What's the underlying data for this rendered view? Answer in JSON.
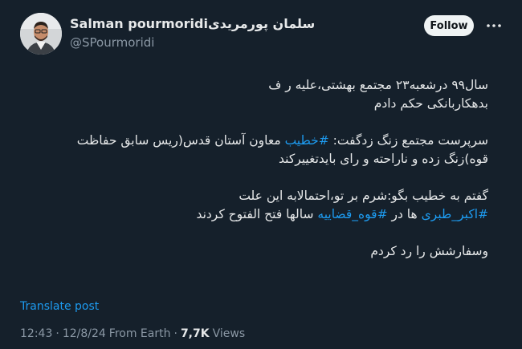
{
  "author": {
    "display_name_latin": "Salman pourmoridi",
    "display_name_persian": "سلمان پورمریدی",
    "handle": "@SPourmoridi"
  },
  "actions": {
    "follow_label": "Follow",
    "more_icon": "ellipsis-icon"
  },
  "tweet": {
    "paragraphs": [
      {
        "lines": [
          [
            {
              "t": "سال۹۹ درشعبه۲۳ مجتمع بهشتی،علیه ر ف"
            }
          ],
          [
            {
              "t": "بدهکاربانکی حکم دادم"
            }
          ]
        ]
      },
      {
        "lines": [
          [
            {
              "t": "سرپرست مجتمع زنگ زدگفت: "
            },
            {
              "t": "#خطیب",
              "tag": true
            },
            {
              "t": " معاون آستان قدس(ریس سابق حفاظت"
            }
          ],
          [
            {
              "t": "قوه)زنگ زده و ناراحته و رای بایدتغییرکند"
            }
          ]
        ]
      },
      {
        "lines": [
          [
            {
              "t": "گفتم به خطیب بگو:شرم بر تو،احتمالابه این علت"
            }
          ],
          [
            {
              "t": "#اکبر_طبری",
              "tag": true
            },
            {
              "t": " ها در "
            },
            {
              "t": "#قوه_قضاییه",
              "tag": true
            },
            {
              "t": " سالها فتح الفتوح کردند"
            }
          ]
        ]
      },
      {
        "lines": [
          [
            {
              "t": "وسفارشش را رد کردم"
            }
          ]
        ]
      }
    ]
  },
  "translate_label": "Translate post",
  "meta": {
    "time": "12:43",
    "date": "12/8/24",
    "source": "From Earth",
    "separator": "·",
    "views_count": "7,7K",
    "views_label": "Views"
  }
}
